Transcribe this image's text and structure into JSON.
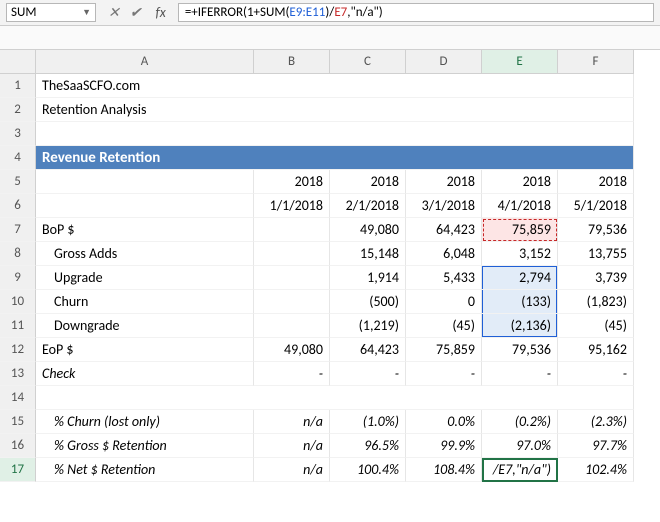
{
  "formula_bar": {
    "name_box": "SUM",
    "formula_prefix": "=+IFERROR(1+SUM(",
    "formula_range": "E9:E11",
    "formula_mid": ")/",
    "formula_ref": "E7",
    "formula_suffix": ",\"n/a\")"
  },
  "columns": [
    "",
    "A",
    "B",
    "C",
    "D",
    "E",
    "F"
  ],
  "row_labels": [
    "1",
    "2",
    "3",
    "4",
    "5",
    "6",
    "7",
    "8",
    "9",
    "10",
    "11",
    "12",
    "13",
    "14",
    "15",
    "16",
    "17"
  ],
  "a1": "TheSaaSCFO.com",
  "a2": "Retention Analysis",
  "section": "Revenue Retention",
  "years": [
    "2018",
    "2018",
    "2018",
    "2018",
    "2018"
  ],
  "dates": [
    "1/1/2018",
    "2/1/2018",
    "3/1/2018",
    "4/1/2018",
    "5/1/2018"
  ],
  "rows": {
    "bop": {
      "label": "BoP $",
      "v": [
        "",
        "49,080",
        "64,423",
        "75,859",
        "79,536"
      ]
    },
    "adds": {
      "label": "Gross Adds",
      "v": [
        "",
        "15,148",
        "6,048",
        "3,152",
        "13,755"
      ]
    },
    "up": {
      "label": "Upgrade",
      "v": [
        "",
        "1,914",
        "5,433",
        "2,794",
        "3,739"
      ]
    },
    "churn": {
      "label": "Churn",
      "v": [
        "",
        "(500)",
        "0",
        "(133)",
        "(1,823)"
      ]
    },
    "down": {
      "label": "Downgrade",
      "v": [
        "",
        "(1,219)",
        "(45)",
        "(2,136)",
        "(45)"
      ]
    },
    "eop": {
      "label": "EoP $",
      "v": [
        "49,080",
        "64,423",
        "75,859",
        "79,536",
        "95,162"
      ]
    },
    "check": {
      "label": "Check",
      "v": [
        "-",
        "-",
        "-",
        "-",
        "-"
      ]
    }
  },
  "pct": {
    "churn": {
      "label": "% Churn (lost only)",
      "v": [
        "n/a",
        "(1.0%)",
        "0.0%",
        "(0.2%)",
        "(2.3%)"
      ]
    },
    "gross": {
      "label": "% Gross $ Retention",
      "v": [
        "n/a",
        "96.5%",
        "99.9%",
        "97.0%",
        "97.7%"
      ]
    },
    "net": {
      "label": "% Net $ Retention",
      "v": [
        "n/a",
        "100.4%",
        "108.4%",
        "/E7,\"n/a\")",
        "102.4%"
      ]
    }
  },
  "chart_data": {
    "type": "table",
    "title": "Revenue Retention",
    "categories": [
      "1/1/2018",
      "2/1/2018",
      "3/1/2018",
      "4/1/2018",
      "5/1/2018"
    ],
    "series": [
      {
        "name": "BoP $",
        "values": [
          null,
          49080,
          64423,
          75859,
          79536
        ]
      },
      {
        "name": "Gross Adds",
        "values": [
          null,
          15148,
          6048,
          3152,
          13755
        ]
      },
      {
        "name": "Upgrade",
        "values": [
          null,
          1914,
          5433,
          2794,
          3739
        ]
      },
      {
        "name": "Churn",
        "values": [
          null,
          -500,
          0,
          -133,
          -1823
        ]
      },
      {
        "name": "Downgrade",
        "values": [
          null,
          -1219,
          -45,
          -2136,
          -45
        ]
      },
      {
        "name": "EoP $",
        "values": [
          49080,
          64423,
          75859,
          79536,
          95162
        ]
      },
      {
        "name": "% Churn (lost only)",
        "values": [
          null,
          -0.01,
          0.0,
          -0.002,
          -0.023
        ]
      },
      {
        "name": "% Gross $ Retention",
        "values": [
          null,
          0.965,
          0.999,
          0.97,
          0.977
        ]
      },
      {
        "name": "% Net $ Retention",
        "values": [
          null,
          1.004,
          1.084,
          null,
          1.024
        ]
      }
    ]
  }
}
